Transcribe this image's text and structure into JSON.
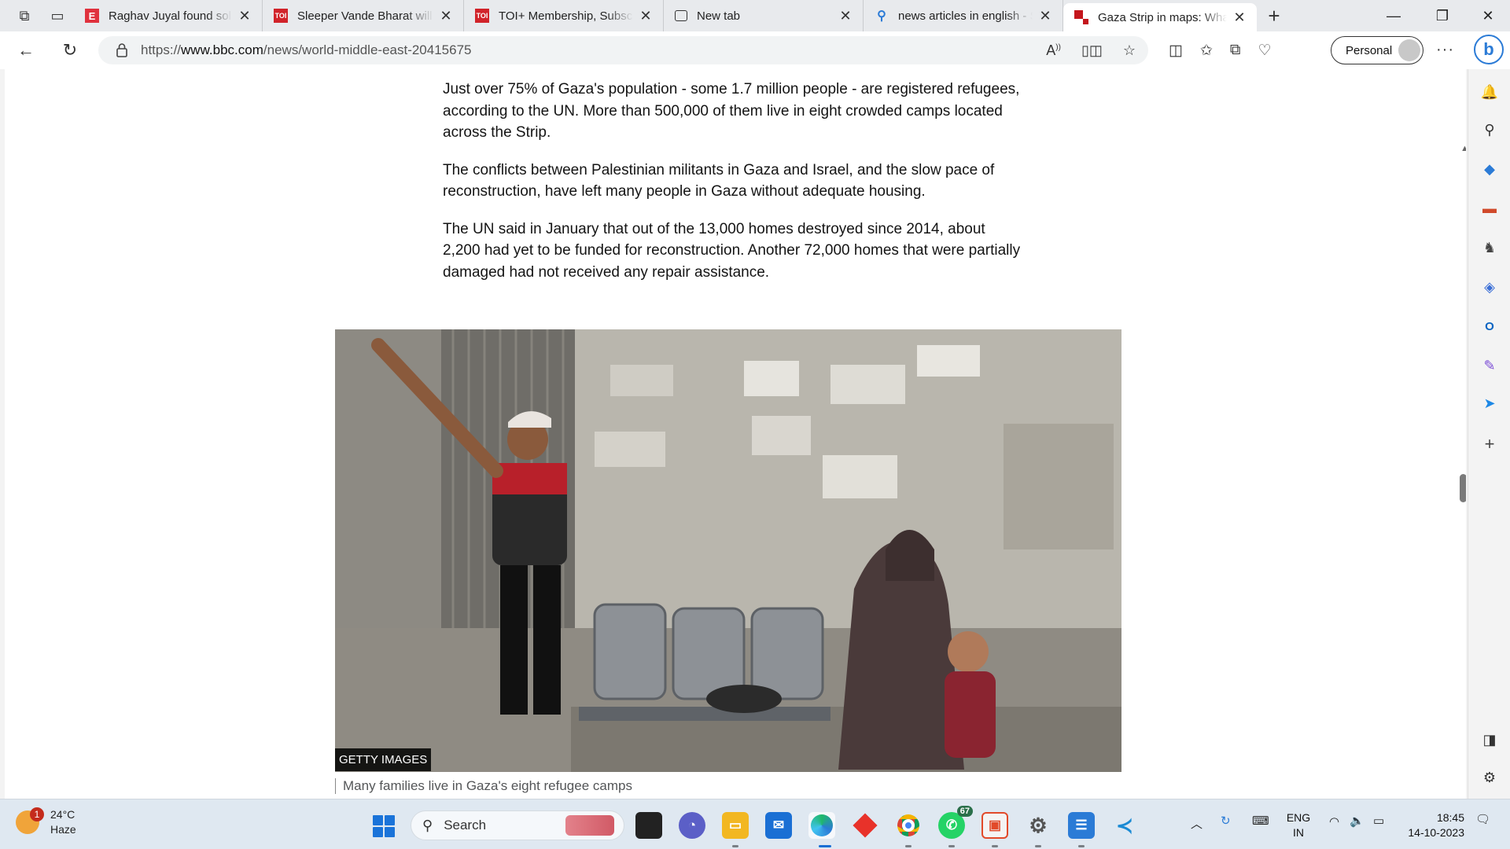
{
  "colors": {
    "accent": "#2b7bd6",
    "bbc_red": "#c4161c",
    "toi_red": "#d1232a",
    "taskbar": "#dfe8f1"
  },
  "tabs": [
    {
      "title": "Raghav Juyal found solace",
      "favicon": "E",
      "favicon_color": "#e0323e"
    },
    {
      "title": "Sleeper Vande Bharat will c",
      "favicon": "TOI",
      "favicon_color": "#d1232a"
    },
    {
      "title": "TOI+ Membership, Subscri",
      "favicon": "TOI",
      "favicon_color": "#d1232a"
    },
    {
      "title": "New tab",
      "favicon": "newtab-icon",
      "favicon_color": "#333333"
    },
    {
      "title": "news articles in english - S",
      "favicon": "search-icon",
      "favicon_color": "#2b7bd6"
    },
    {
      "title": "Gaza Strip in maps: What it",
      "favicon": "bbc-news-icon",
      "favicon_color": "#c4161c",
      "active": true
    }
  ],
  "address_bar": {
    "url_prefix": "https://",
    "url_domain": "www.bbc.com",
    "url_path": "/news/world-middle-east-20415675"
  },
  "profile": {
    "label": "Personal"
  },
  "article": {
    "paragraphs": [
      "Just over 75% of Gaza's population - some 1.7 million people - are registered refugees, according to the UN. More than 500,000 of them live in eight crowded camps located across the Strip.",
      "The conflicts between Palestinian militants in Gaza and Israel, and the slow pace of reconstruction, have left many people in Gaza without adequate housing.",
      "The UN said in January that out of the 13,000 homes destroyed since 2014, about 2,200 had yet to be funded for reconstruction. Another 72,000 homes that were partially damaged had not received any repair assistance."
    ],
    "image_credit": "GETTY IMAGES",
    "image_caption": "Many families live in Gaza's eight refugee camps"
  },
  "sidebar_icons": [
    "bell-icon",
    "search-icon",
    "shopping-tag-icon",
    "toolbox-icon",
    "games-icon",
    "copilot-icon",
    "outlook-icon",
    "designer-icon",
    "send-icon",
    "add-icon",
    "split-screen-icon",
    "settings-icon"
  ],
  "taskbar": {
    "weather": {
      "temp": "24°C",
      "condition": "Haze",
      "badge": "1"
    },
    "search_label": "Search",
    "whatsapp_badge": "67",
    "tray": {
      "lang_line1": "ENG",
      "lang_line2": "IN"
    },
    "clock": {
      "time": "18:45",
      "date": "14-10-2023"
    }
  }
}
